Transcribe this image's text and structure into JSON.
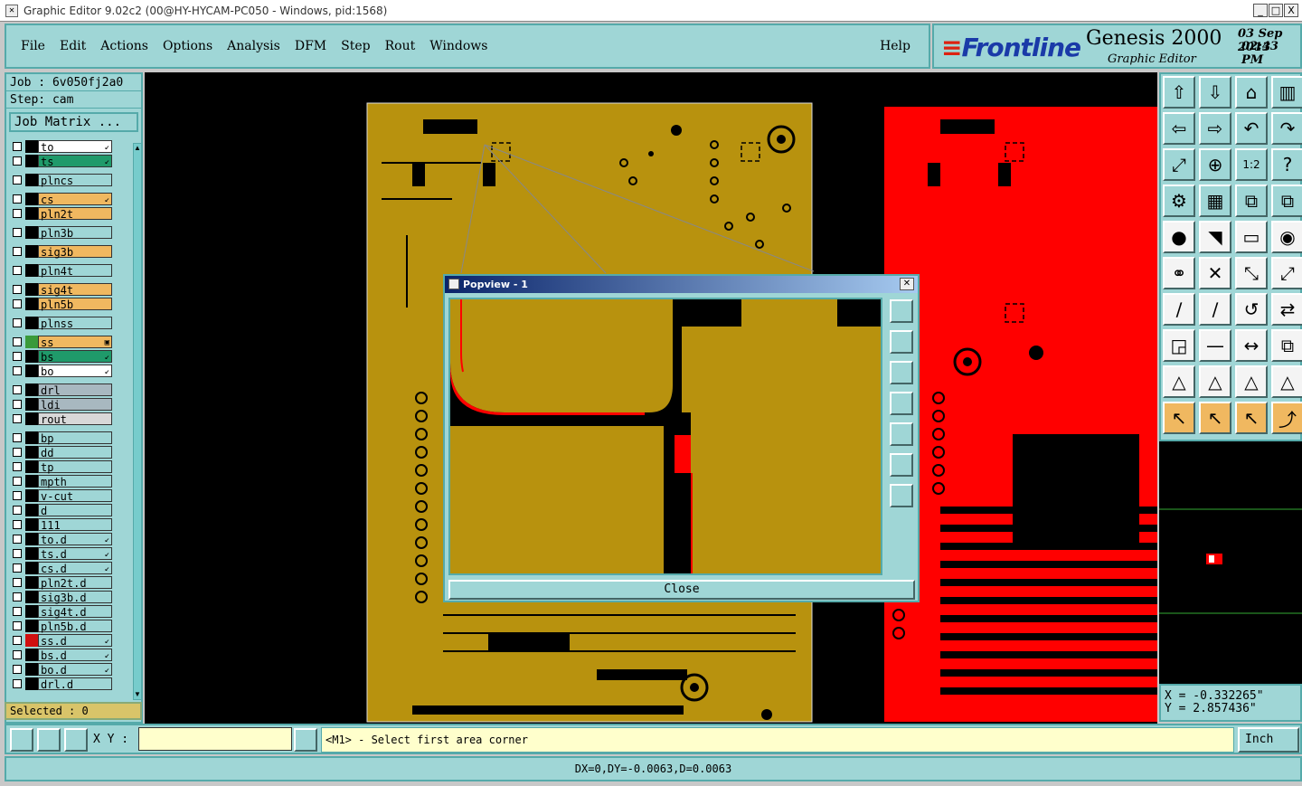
{
  "window": {
    "title": "Graphic Editor 9.02c2 (00@HY-HYCAM-PC050 - Windows, pid:1568)",
    "controls": [
      "_",
      "□",
      "X"
    ]
  },
  "menu": {
    "items": [
      "File",
      "Edit",
      "Actions",
      "Options",
      "Analysis",
      "DFM",
      "Step",
      "Rout",
      "Windows"
    ],
    "help": "Help"
  },
  "brand": {
    "logo": "Frontline",
    "product": "Genesis 2000",
    "subtitle": "Graphic Editor",
    "date": "03 Sep 2013",
    "time": "02:43 PM"
  },
  "job": {
    "job_label": "Job : 6v050fj2a0",
    "step_label": "Step: cam",
    "matrix_button": "Job Matrix ..."
  },
  "layers": [
    {
      "name": "to",
      "color": "#ffffff",
      "swatch": "#000000",
      "flag": "↙"
    },
    {
      "name": "ts",
      "color": "#1f9a6a",
      "swatch": "#000000",
      "flag": "↙"
    },
    {
      "name": "plncs",
      "color": "#9fd6d6",
      "swatch": "#000000",
      "flag": ""
    },
    {
      "name": "cs",
      "color": "#f0b860",
      "swatch": "#000000",
      "flag": "↙"
    },
    {
      "name": "pln2t",
      "color": "#f0b860",
      "swatch": "#000000",
      "flag": ""
    },
    {
      "name": "pln3b",
      "color": "#9fd6d6",
      "swatch": "#000000",
      "flag": ""
    },
    {
      "name": "sig3b",
      "color": "#f0b860",
      "swatch": "#000000",
      "flag": ""
    },
    {
      "name": "pln4t",
      "color": "#9fd6d6",
      "swatch": "#000000",
      "flag": ""
    },
    {
      "name": "sig4t",
      "color": "#f0b860",
      "swatch": "#000000",
      "flag": ""
    },
    {
      "name": "pln5b",
      "color": "#f0b860",
      "swatch": "#000000",
      "flag": ""
    },
    {
      "name": "plnss",
      "color": "#9fd6d6",
      "swatch": "#000000",
      "flag": ""
    },
    {
      "name": "ss",
      "color": "#f0b860",
      "swatch": "#3a9a3a",
      "flag": "▣"
    },
    {
      "name": "bs",
      "color": "#1f9a6a",
      "swatch": "#000000",
      "flag": "↙"
    },
    {
      "name": "bo",
      "color": "#ffffff",
      "swatch": "#000000",
      "flag": "↙"
    },
    {
      "name": "drl",
      "color": "#a8b8c0",
      "swatch": "#000000",
      "flag": ""
    },
    {
      "name": "ldi",
      "color": "#a8b8c0",
      "swatch": "#000000",
      "flag": ""
    },
    {
      "name": "rout",
      "color": "#d8d8d8",
      "swatch": "#000000",
      "flag": ""
    },
    {
      "name": "bp",
      "color": "#9fd6d6",
      "swatch": "#000000",
      "flag": ""
    },
    {
      "name": "dd",
      "color": "#9fd6d6",
      "swatch": "#000000",
      "flag": ""
    },
    {
      "name": "tp",
      "color": "#9fd6d6",
      "swatch": "#000000",
      "flag": ""
    },
    {
      "name": "mpth",
      "color": "#9fd6d6",
      "swatch": "#000000",
      "flag": ""
    },
    {
      "name": "v-cut",
      "color": "#9fd6d6",
      "swatch": "#000000",
      "flag": ""
    },
    {
      "name": "d",
      "color": "#9fd6d6",
      "swatch": "#000000",
      "flag": ""
    },
    {
      "name": "111",
      "color": "#9fd6d6",
      "swatch": "#000000",
      "flag": ""
    },
    {
      "name": "to.d",
      "color": "#9fd6d6",
      "swatch": "#000000",
      "flag": "↙"
    },
    {
      "name": "ts.d",
      "color": "#9fd6d6",
      "swatch": "#000000",
      "flag": "↙"
    },
    {
      "name": "cs.d",
      "color": "#9fd6d6",
      "swatch": "#000000",
      "flag": "↙"
    },
    {
      "name": "pln2t.d",
      "color": "#9fd6d6",
      "swatch": "#000000",
      "flag": ""
    },
    {
      "name": "sig3b.d",
      "color": "#9fd6d6",
      "swatch": "#000000",
      "flag": ""
    },
    {
      "name": "sig4t.d",
      "color": "#9fd6d6",
      "swatch": "#000000",
      "flag": ""
    },
    {
      "name": "pln5b.d",
      "color": "#9fd6d6",
      "swatch": "#000000",
      "flag": ""
    },
    {
      "name": "ss.d",
      "color": "#9fd6d6",
      "swatch": "#d01010",
      "flag": "↙"
    },
    {
      "name": "bs.d",
      "color": "#9fd6d6",
      "swatch": "#000000",
      "flag": "↙"
    },
    {
      "name": "bo.d",
      "color": "#9fd6d6",
      "swatch": "#000000",
      "flag": "↙"
    },
    {
      "name": "drl.d",
      "color": "#9fd6d6",
      "swatch": "#000000",
      "flag": ""
    }
  ],
  "selected_label": "Selected : 0",
  "popview": {
    "title": "Popview - 1",
    "close_label": "Close"
  },
  "coords": {
    "x": "X = -0.332265\"",
    "y": "Y = 2.857436\""
  },
  "bottom": {
    "xy_label": "X Y :",
    "xy_value": "",
    "message": "<M1> - Select first area corner",
    "unit": "Inch"
  },
  "status": "DX=0,DY=-0.0063,D=0.0063",
  "colors": {
    "board_gold": "#b8920e",
    "board_red": "#ff0000",
    "panel_cyan": "#9fd6d6"
  }
}
